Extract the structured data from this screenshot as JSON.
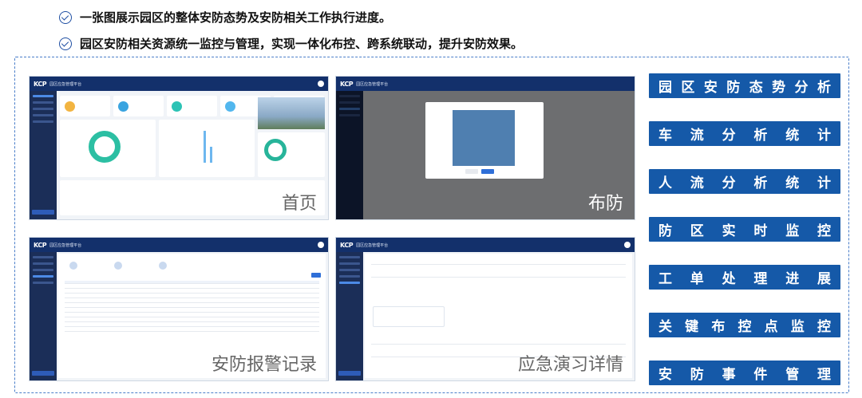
{
  "headlines": [
    "一张图展示园区的整体安防态势及安防相关工作执行进度。",
    "园区安防相关资源统一监控与管理，实现一体化布控、跨系统联动，提升安防效果。"
  ],
  "screens": [
    {
      "caption": "首页",
      "logo": "KCP",
      "app_title": "园区应急管理平台"
    },
    {
      "caption": "布防",
      "logo": "KCP",
      "app_title": "园区应急管理平台"
    },
    {
      "caption": "安防报警记录",
      "logo": "KCP",
      "app_title": "园区应急管理平台"
    },
    {
      "caption": "应急演习详情",
      "logo": "KCP",
      "app_title": "园区应急管理平台"
    }
  ],
  "features": [
    "园区安防态势分析",
    "车流分析统计",
    "人流分析统计",
    "防区实时监控",
    "工单处理进展",
    "关键布控点监控",
    "安防事件管理"
  ],
  "colors": {
    "feature_bg": "#1559a8",
    "topbar": "#13306b",
    "sidebar": "#1b2e58",
    "frame": "#4a7ec9"
  }
}
